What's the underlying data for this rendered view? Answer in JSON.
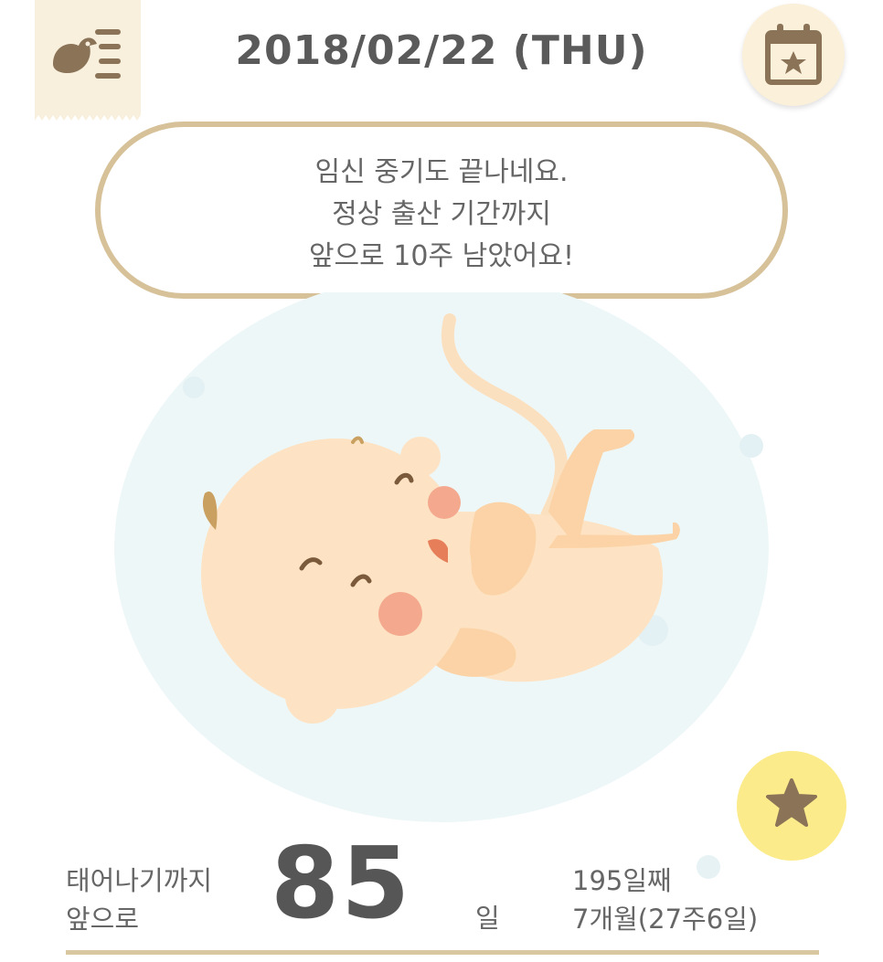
{
  "header": {
    "date": "2018/02/22 (THU)",
    "menu_icon": "bird-list-menu-icon",
    "calendar_icon": "calendar-star-icon"
  },
  "speech": {
    "line1": "임신 중기도 끝나네요.",
    "line2": "정상 출산 기간까지",
    "line3": "앞으로 10주 남았어요!"
  },
  "countdown": {
    "label_line1": "태어나기까지",
    "label_line2": "앞으로",
    "days_left": "85",
    "unit": "일",
    "day_count": "195일째",
    "pregnancy_age": "7개월(27주6일)"
  },
  "actions": {
    "favorite_icon": "star-icon"
  },
  "colors": {
    "bubble_border": "#d6c199",
    "favorite_bg": "#fbeb8a",
    "calendar_bg": "#fbf0d9",
    "rule": "#d9c7a2"
  }
}
